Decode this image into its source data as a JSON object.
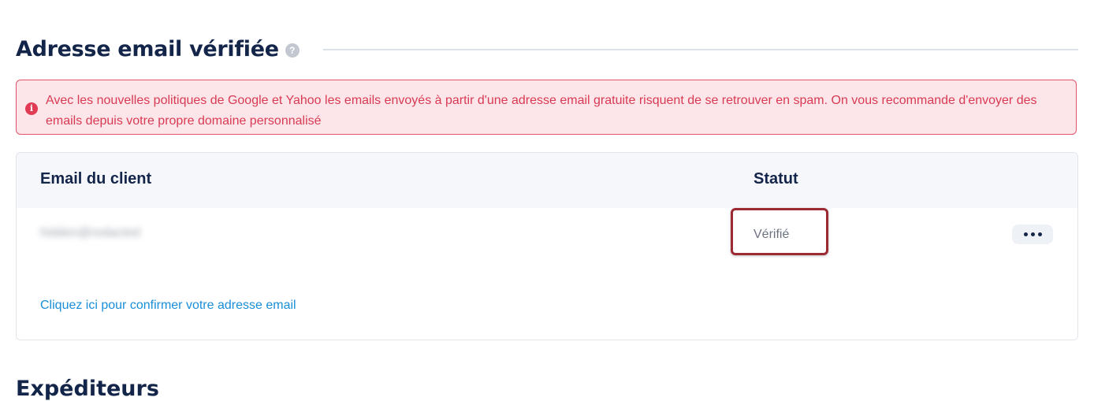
{
  "section": {
    "title": "Adresse email vérifiée",
    "help_icon": "?"
  },
  "alert": {
    "icon": "i",
    "text": "Avec les nouvelles politiques de Google et Yahoo les emails envoyés à partir d'une adresse email gratuite risquent de se retrouver en spam. On vous recommande d'envoyer des emails depuis votre propre domaine personnalisé"
  },
  "table": {
    "columns": [
      "Email du client",
      "Statut"
    ],
    "rows": [
      {
        "email": "hidden@redacted",
        "status": "Vérifié"
      }
    ]
  },
  "confirm_link": "Cliquez ici pour confirmer votre adresse email",
  "next_section": {
    "title": "Expéditeurs"
  },
  "colors": {
    "title": "#14254a",
    "alert_text": "#d93a53",
    "alert_bg": "#fde6ea",
    "alert_border": "#e2526c",
    "link": "#1a8ed8",
    "highlight_border": "#9b2a33"
  }
}
